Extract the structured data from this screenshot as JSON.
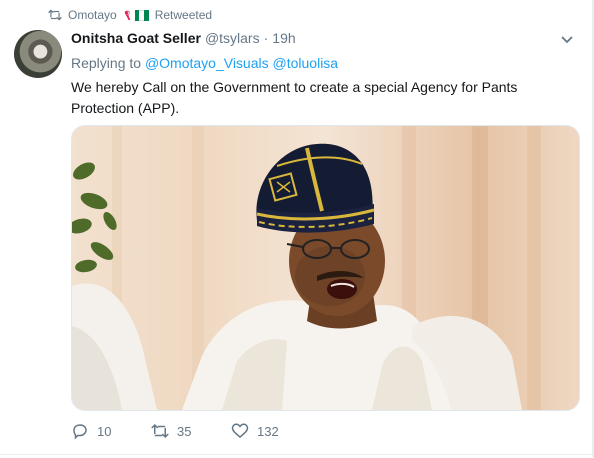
{
  "retweet": {
    "by": "Omotayo",
    "label": "Retweeted"
  },
  "author": {
    "name": "Onitsha Goat Seller",
    "handle": "@tsylars",
    "separator": "·",
    "time": "19h"
  },
  "reply": {
    "prefix": "Replying to",
    "mentions": [
      "@Omotayo_Visuals",
      "@toluolisa"
    ]
  },
  "tweet_text": "We hereby Call on the Government to create a special Agency for Pants Protection (APP).",
  "stats": {
    "replies": "10",
    "retweets": "35",
    "likes": "132"
  },
  "colors": {
    "accent": "#1da1f2",
    "muted": "#657786",
    "text": "#14171a",
    "flag_green": "#008751"
  },
  "icons": {
    "retweeted": "retweet-icon",
    "menu": "chevron-down-icon",
    "reply": "reply-icon",
    "retweet": "retweet-icon",
    "like": "heart-icon"
  }
}
